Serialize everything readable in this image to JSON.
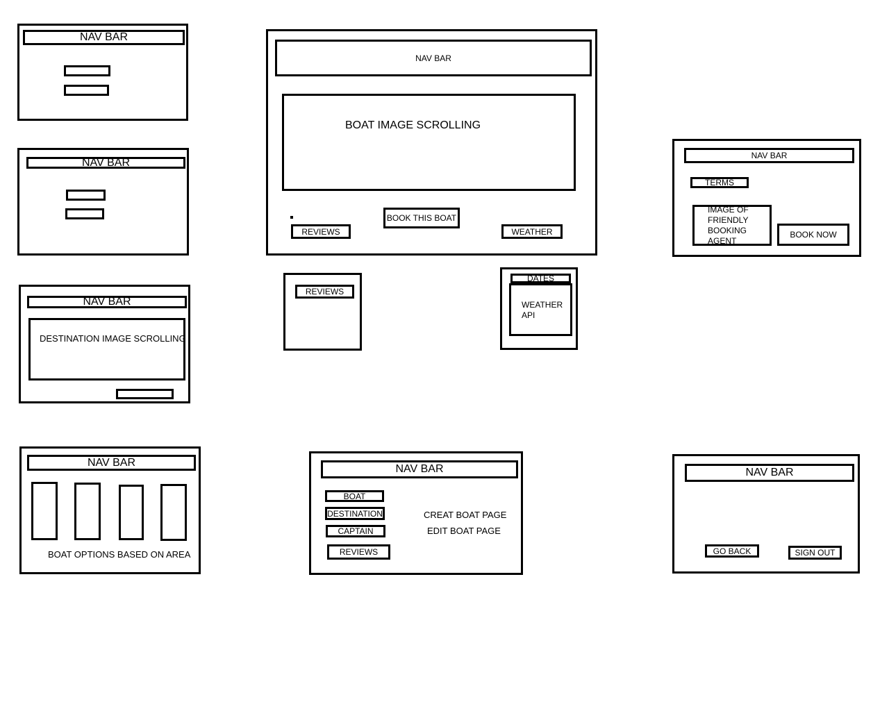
{
  "nav_bar": "NAV BAR",
  "login": {},
  "signup": {},
  "destinations": {
    "image": "DESTINATION IMAGE SCROLLING"
  },
  "boat_options": {
    "caption": "BOAT OPTIONS BASED ON AREA"
  },
  "boat_page": {
    "image": "BOAT IMAGE SCROLLING",
    "reviews": "REVIEWS",
    "book": "BOOK THIS BOAT",
    "weather": "WEATHER"
  },
  "reviews_panel": {
    "reviews": "REVIEWS"
  },
  "weather_panel": {
    "dates": "DATES",
    "api": "WEATHER API"
  },
  "booking": {
    "terms": "TERMS",
    "agent": "IMAGE OF FRIENDLY BOOKING AGENT",
    "book_now": "BOOK NOW"
  },
  "admin": {
    "boat": "BOAT",
    "destination": "DESTINATION",
    "captain": "CAPTAIN",
    "reviews": "REVIEWS",
    "create": "CREAT BOAT PAGE",
    "edit": "EDIT BOAT PAGE"
  },
  "signout": {
    "go_back": "GO BACK",
    "sign_out": "SIGN OUT"
  }
}
